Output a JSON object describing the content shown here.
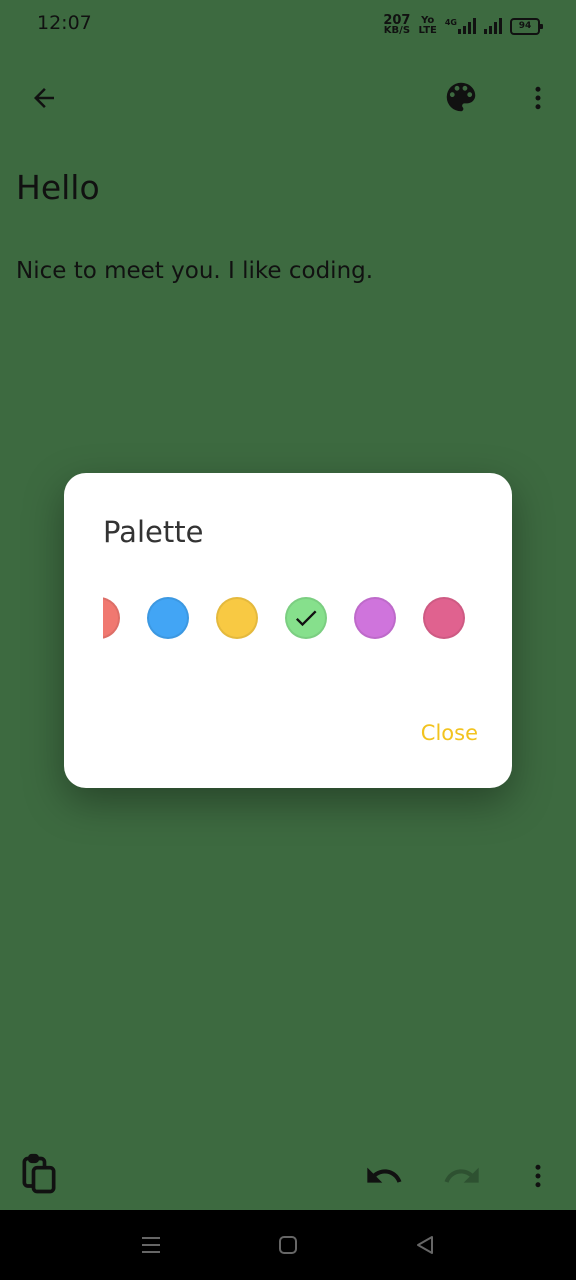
{
  "status_bar": {
    "time": "12:07",
    "net_speed_value": "207",
    "net_speed_unit": "KB/S",
    "volte_top": "Yo",
    "volte_bottom": "LTE",
    "network_type": "4G",
    "battery": "94"
  },
  "app_bar": {
    "back_icon": "arrow-back",
    "palette_icon": "palette",
    "more_icon": "more-vertical"
  },
  "note": {
    "title": "Hello",
    "body": "Nice to meet you. I like coding."
  },
  "palette_dialog": {
    "title": "Palette",
    "colors": [
      "#f07870",
      "#42a5f5",
      "#f8c943",
      "#86e08c",
      "#cf74dc",
      "#e0628f"
    ],
    "selected_index": 3,
    "close_label": "Close",
    "close_color": "#f2c31f"
  },
  "bottom_toolbar": {
    "copy_icon": "copy",
    "undo_icon": "undo",
    "redo_icon": "redo",
    "more_icon": "more-vertical"
  },
  "nav_bar": {
    "menu_icon": "menu",
    "home_icon": "home",
    "back_icon": "back-triangle"
  },
  "colors": {
    "background": "#3d6a40",
    "dialog_background": "#ffffff",
    "nav_background": "#000000"
  }
}
